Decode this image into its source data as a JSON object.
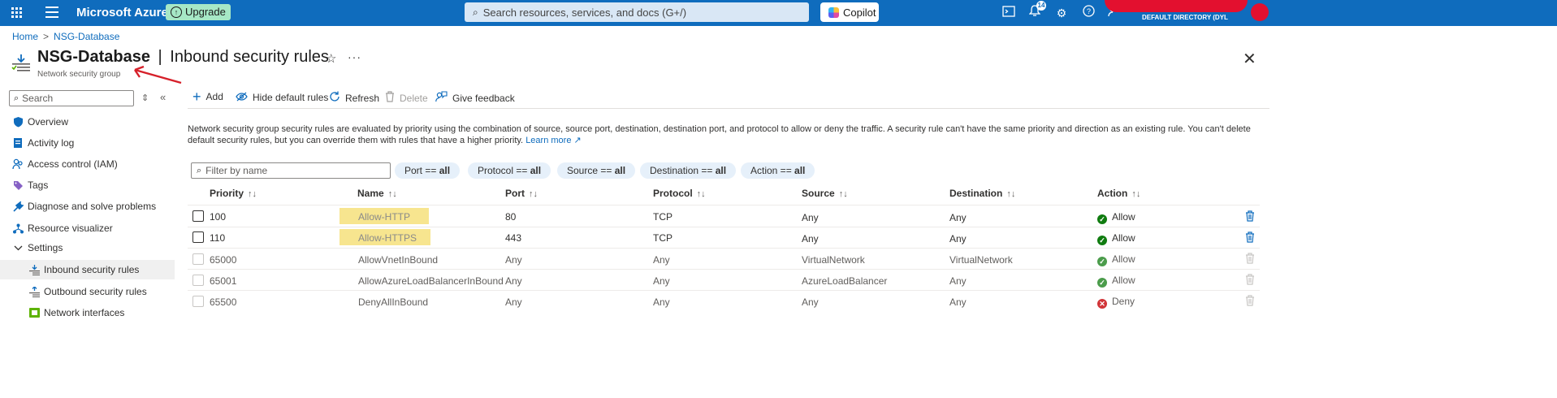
{
  "topbar": {
    "brand": "Microsoft Azure",
    "upgrade_label": "Upgrade",
    "search_placeholder": "Search resources, services, and docs (G+/)",
    "copilot_label": "Copilot",
    "notification_count": "14",
    "directory": "DEFAULT DIRECTORY (DYLEARNI...",
    "accent": "#0f6cbd"
  },
  "breadcrumb": {
    "home": "Home",
    "current": "NSG-Database"
  },
  "header": {
    "resource_name": "NSG-Database",
    "separator": "|",
    "page": "Inbound security rules",
    "subtitle": "Network security group"
  },
  "sidebar": {
    "search_placeholder": "Search",
    "items": [
      {
        "label": "Overview",
        "icon": "shield-icon"
      },
      {
        "label": "Activity log",
        "icon": "log-icon"
      },
      {
        "label": "Access control (IAM)",
        "icon": "people-icon"
      },
      {
        "label": "Tags",
        "icon": "tag-icon"
      },
      {
        "label": "Diagnose and solve problems",
        "icon": "wrench-icon"
      },
      {
        "label": "Resource visualizer",
        "icon": "network-icon"
      },
      {
        "label": "Settings",
        "icon": "chevron-down-icon"
      },
      {
        "label": "Inbound security rules",
        "icon": "inbound-rules-icon",
        "active": true
      },
      {
        "label": "Outbound security rules",
        "icon": "outbound-rules-icon"
      },
      {
        "label": "Network interfaces",
        "icon": "nic-icon"
      }
    ]
  },
  "commands": {
    "add": "Add",
    "hide_default": "Hide default rules",
    "refresh": "Refresh",
    "delete": "Delete",
    "feedback": "Give feedback"
  },
  "description": {
    "text": "Network security group security rules are evaluated by priority using the combination of source, source port, destination, destination port, and protocol to allow or deny the traffic. A security rule can't have the same priority and direction as an existing rule. You can't delete default security rules, but you can override them with rules that have a higher priority.",
    "link": "Learn more"
  },
  "filters": {
    "placeholder": "Filter by name",
    "pills": [
      {
        "label": "Port == ",
        "value": "all"
      },
      {
        "label": "Protocol == ",
        "value": "all"
      },
      {
        "label": "Source == ",
        "value": "all"
      },
      {
        "label": "Destination == ",
        "value": "all"
      },
      {
        "label": "Action == ",
        "value": "all"
      }
    ]
  },
  "table": {
    "columns": [
      "Priority",
      "Name",
      "Port",
      "Protocol",
      "Source",
      "Destination",
      "Action"
    ],
    "rows": [
      {
        "priority": "100",
        "name": "Allow-HTTP",
        "port": "80",
        "protocol": "TCP",
        "source": "Any",
        "destination": "Any",
        "action": "Allow",
        "custom": true
      },
      {
        "priority": "110",
        "name": "Allow-HTTPS",
        "port": "443",
        "protocol": "TCP",
        "source": "Any",
        "destination": "Any",
        "action": "Allow",
        "custom": true
      },
      {
        "priority": "65000",
        "name": "AllowVnetInBound",
        "port": "Any",
        "protocol": "Any",
        "source": "VirtualNetwork",
        "destination": "VirtualNetwork",
        "action": "Allow",
        "custom": false
      },
      {
        "priority": "65001",
        "name": "AllowAzureLoadBalancerInBound",
        "port": "Any",
        "protocol": "Any",
        "source": "AzureLoadBalancer",
        "destination": "Any",
        "action": "Allow",
        "custom": false
      },
      {
        "priority": "65500",
        "name": "DenyAllInBound",
        "port": "Any",
        "protocol": "Any",
        "source": "Any",
        "destination": "Any",
        "action": "Deny",
        "custom": false
      }
    ]
  }
}
